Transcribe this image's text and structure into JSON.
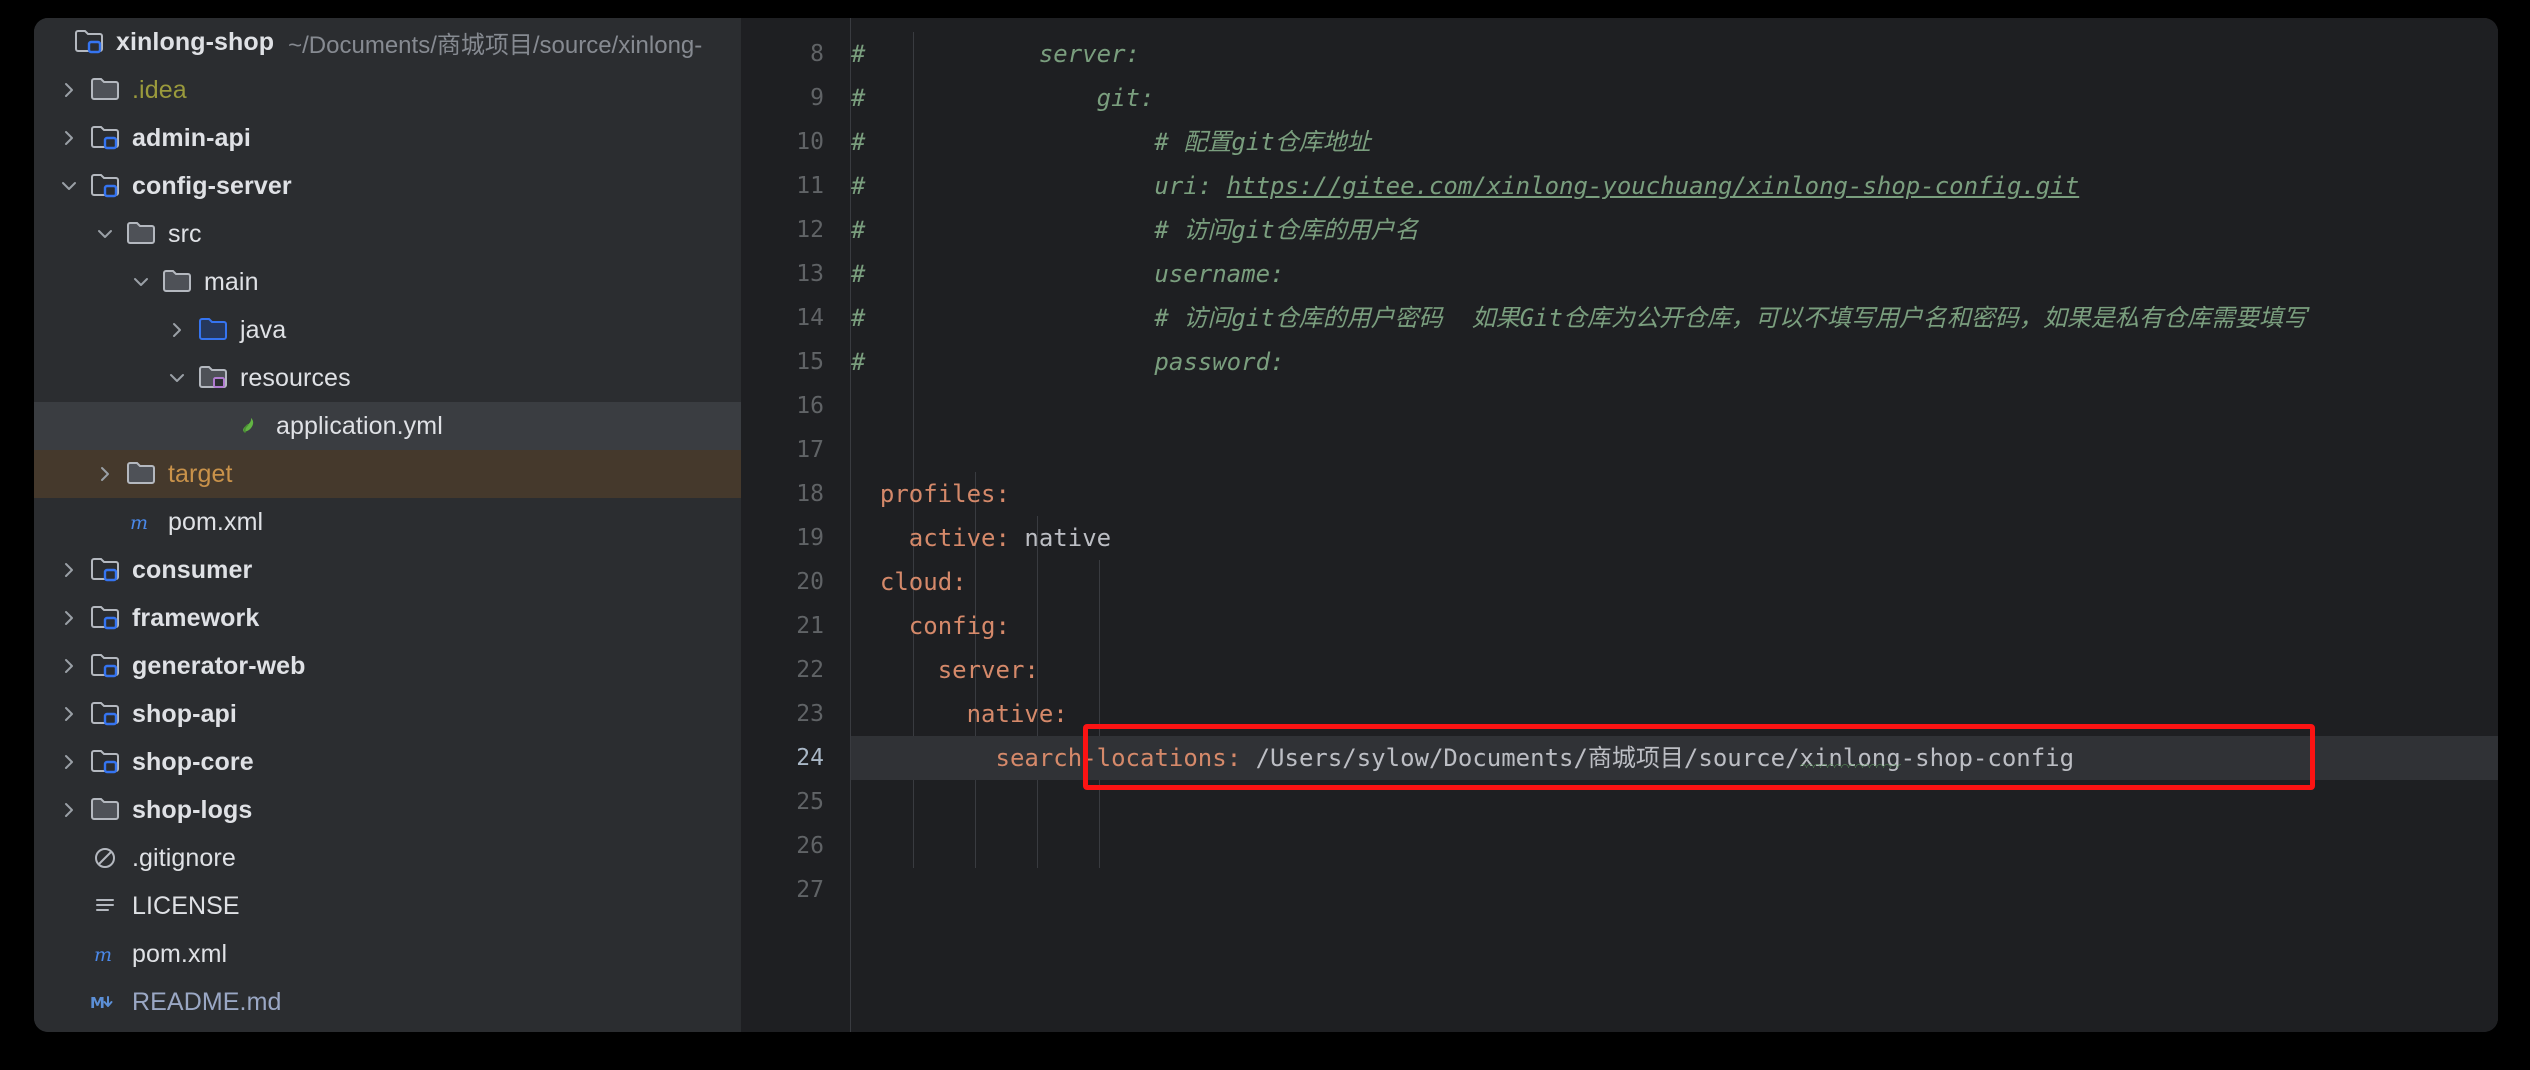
{
  "window": {
    "app": "IntelliJ IDEA",
    "background": "#000000",
    "panel_bg": "#2b2d30",
    "editor_bg": "#1e1f22",
    "accent_red": "#fc1313",
    "selection_bg": "#3a3d41",
    "target_bg": "#45392c"
  },
  "project_tree": {
    "root": {
      "name": "xinlong-shop",
      "path": "~/Documents/商城项目/source/xinlong-",
      "icon": "module-folder-icon",
      "expanded": true
    },
    "items": [
      {
        "label": ".idea",
        "icon": "folder-icon",
        "indent": 1,
        "arrow": "collapsed",
        "style": "yellowish",
        "selected": false
      },
      {
        "label": "admin-api",
        "icon": "module-folder-icon",
        "indent": 1,
        "arrow": "collapsed",
        "style": "bold",
        "selected": false
      },
      {
        "label": "config-server",
        "icon": "module-folder-icon",
        "indent": 1,
        "arrow": "expanded",
        "style": "bold",
        "selected": false
      },
      {
        "label": "src",
        "icon": "folder-icon",
        "indent": 2,
        "arrow": "expanded",
        "style": "plain",
        "selected": false
      },
      {
        "label": "main",
        "icon": "folder-icon",
        "indent": 3,
        "arrow": "expanded",
        "style": "plain",
        "selected": false
      },
      {
        "label": "java",
        "icon": "source-folder-icon",
        "indent": 4,
        "arrow": "collapsed",
        "style": "plain",
        "selected": false
      },
      {
        "label": "resources",
        "icon": "resource-folder-icon",
        "indent": 4,
        "arrow": "expanded",
        "style": "plain",
        "selected": false
      },
      {
        "label": "application.yml",
        "icon": "yaml-file-icon",
        "indent": 5,
        "arrow": "none",
        "style": "plain",
        "selected": true
      },
      {
        "label": "target",
        "icon": "folder-icon",
        "indent": 2,
        "arrow": "collapsed",
        "style": "orange",
        "selected": false,
        "target": true
      },
      {
        "label": "pom.xml",
        "icon": "maven-file-icon",
        "indent": 2,
        "arrow": "none",
        "style": "plain",
        "selected": false
      },
      {
        "label": "consumer",
        "icon": "module-folder-icon",
        "indent": 1,
        "arrow": "collapsed",
        "style": "bold",
        "selected": false
      },
      {
        "label": "framework",
        "icon": "module-folder-icon",
        "indent": 1,
        "arrow": "collapsed",
        "style": "bold",
        "selected": false
      },
      {
        "label": "generator-web",
        "icon": "module-folder-icon",
        "indent": 1,
        "arrow": "collapsed",
        "style": "bold",
        "selected": false
      },
      {
        "label": "shop-api",
        "icon": "module-folder-icon",
        "indent": 1,
        "arrow": "collapsed",
        "style": "bold",
        "selected": false
      },
      {
        "label": "shop-core",
        "icon": "module-folder-icon",
        "indent": 1,
        "arrow": "collapsed",
        "style": "bold",
        "selected": false
      },
      {
        "label": "shop-logs",
        "icon": "folder-icon",
        "indent": 1,
        "arrow": "collapsed",
        "style": "bold",
        "selected": false
      },
      {
        "label": ".gitignore",
        "icon": "gitignore-file-icon",
        "indent": 1,
        "arrow": "none",
        "style": "plain",
        "selected": false
      },
      {
        "label": "LICENSE",
        "icon": "text-file-icon",
        "indent": 1,
        "arrow": "none",
        "style": "plain",
        "selected": false
      },
      {
        "label": "pom.xml",
        "icon": "maven-file-icon",
        "indent": 1,
        "arrow": "none",
        "style": "plain",
        "selected": false
      },
      {
        "label": "README.md",
        "icon": "markdown-file-icon",
        "indent": 1,
        "arrow": "none",
        "style": "readme",
        "selected": false
      }
    ]
  },
  "editor": {
    "file": "application.yml",
    "language": "yaml",
    "active_line": 24,
    "first_line": 8,
    "lines": [
      {
        "n": 8,
        "text": "#            server:"
      },
      {
        "n": 9,
        "text": "#                git:"
      },
      {
        "n": 10,
        "text": "#                    # 配置git仓库地址"
      },
      {
        "n": 11,
        "text": "#                    uri: https://gitee.com/xinlong-youchuang/xinlong-shop-config.git"
      },
      {
        "n": 12,
        "text": "#                    # 访问git仓库的用户名"
      },
      {
        "n": 13,
        "text": "#                    username:"
      },
      {
        "n": 14,
        "text": "#                    # 访问git仓库的用户密码  如果Git仓库为公开仓库，可以不填写用户名和密码，如果是私有仓库需要填写"
      },
      {
        "n": 15,
        "text": "#                    password:"
      },
      {
        "n": 16,
        "text": ""
      },
      {
        "n": 17,
        "text": ""
      },
      {
        "n": 18,
        "text": "  profiles:"
      },
      {
        "n": 19,
        "text": "    active: native"
      },
      {
        "n": 20,
        "text": "  cloud:"
      },
      {
        "n": 21,
        "text": "    config:"
      },
      {
        "n": 22,
        "text": "      server:"
      },
      {
        "n": 23,
        "text": "        native:"
      },
      {
        "n": 24,
        "text": "          search-locations: /Users/sylow/Documents/商城项目/source/xinlong-shop-config"
      },
      {
        "n": 25,
        "text": ""
      },
      {
        "n": 26,
        "text": ""
      },
      {
        "n": 27,
        "text": ""
      }
    ],
    "tokens": {
      "line11_prefix": "#                    ",
      "line11_uri_key": "uri: ",
      "line11_url": "https://gitee.com/xinlong-youchuang/xinlong-shop-config.git",
      "line24_indent": "          ",
      "line24_key": "search-locations:",
      "line24_value_a": " /Users/sylow/Documents/商城项目/source/",
      "line24_value_b": "xinlong",
      "line24_value_c": "-shop-config"
    },
    "annotation": {
      "type": "rectangle",
      "color": "#fc1313",
      "targets_line": 24
    }
  }
}
